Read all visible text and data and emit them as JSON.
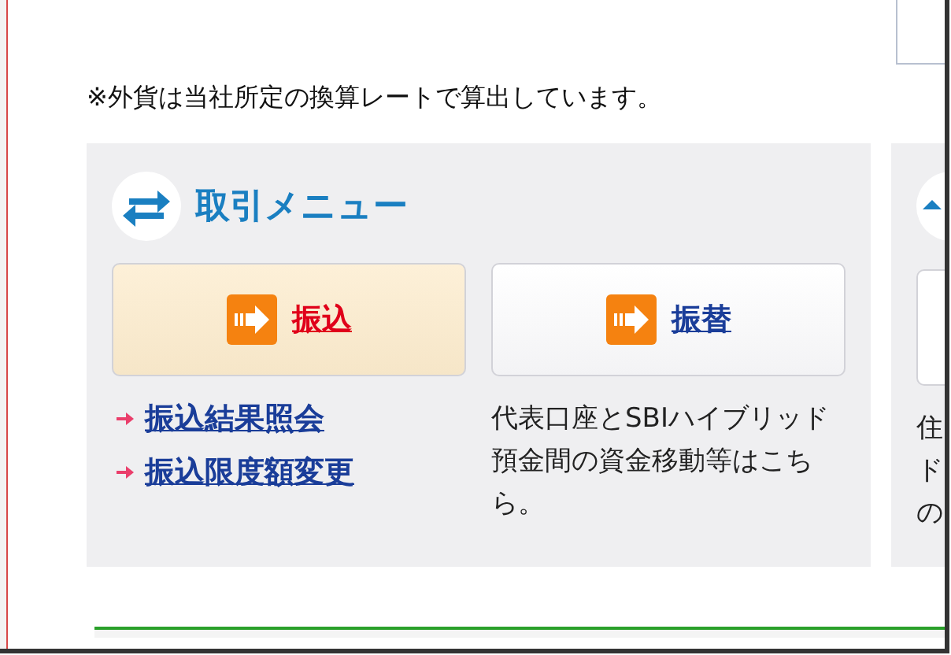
{
  "note": "※外貨は当社所定の換算レートで算出しています。",
  "menu": {
    "title": "取引メニュー",
    "buttons": [
      {
        "label": "振込",
        "selected": true
      },
      {
        "label": "振替",
        "selected": false
      }
    ],
    "links": [
      "振込結果照会",
      "振込限度額変更"
    ],
    "description": "代表口座とSBIハイブリッド預金間の資金移動等はこちら。"
  },
  "cut_panel": {
    "text_lines": [
      "住",
      "ド",
      "の"
    ]
  }
}
